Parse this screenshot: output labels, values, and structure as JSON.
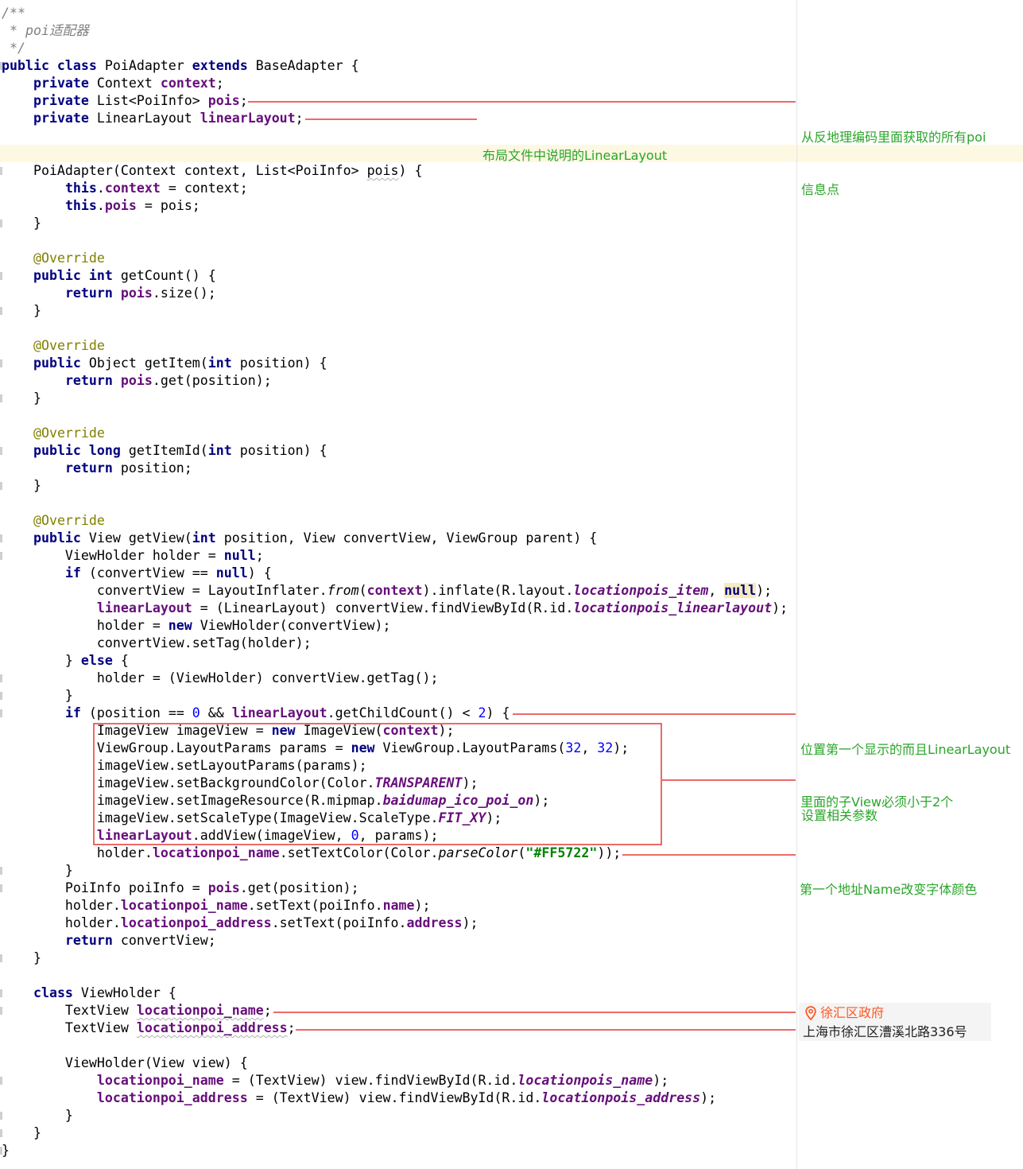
{
  "code": [
    [
      [
        "cmt",
        "/**"
      ]
    ],
    [
      [
        "cmt",
        " * poi适配器"
      ]
    ],
    [
      [
        "cmt",
        " */"
      ]
    ],
    [
      [
        "kw",
        "public class "
      ],
      [
        "",
        "PoiAdapter "
      ],
      [
        "kw",
        "extends "
      ],
      [
        "",
        "BaseAdapter {"
      ]
    ],
    [
      [
        "",
        "    "
      ],
      [
        "kw",
        "private "
      ],
      [
        "",
        "Context "
      ],
      [
        "fld",
        "context"
      ],
      [
        "",
        ";"
      ]
    ],
    [
      [
        "",
        "    "
      ],
      [
        "kw",
        "private "
      ],
      [
        "",
        "List<PoiInfo> "
      ],
      [
        "fld",
        "pois"
      ],
      [
        "",
        ";"
      ]
    ],
    [
      [
        "",
        "    "
      ],
      [
        "kw",
        "private "
      ],
      [
        "",
        "LinearLayout "
      ],
      [
        "fld",
        "linearLayout"
      ],
      [
        "",
        ";"
      ]
    ],
    [],
    [],
    [
      [
        "",
        "    PoiAdapter(Context context, List<PoiInfo> "
      ],
      [
        "sq",
        "pois"
      ],
      [
        "",
        ") {"
      ]
    ],
    [
      [
        "",
        "        "
      ],
      [
        "kw",
        "this"
      ],
      [
        "",
        "."
      ],
      [
        "fld",
        "context"
      ],
      [
        "",
        " = context;"
      ]
    ],
    [
      [
        "",
        "        "
      ],
      [
        "kw",
        "this"
      ],
      [
        "",
        "."
      ],
      [
        "fld",
        "pois"
      ],
      [
        "",
        " = pois;"
      ]
    ],
    [
      [
        "",
        "    }"
      ]
    ],
    [],
    [
      [
        "",
        "    "
      ],
      [
        "ann",
        "@Override"
      ]
    ],
    [
      [
        "",
        "    "
      ],
      [
        "kw",
        "public int "
      ],
      [
        "",
        "getCount() {"
      ]
    ],
    [
      [
        "",
        "        "
      ],
      [
        "kw",
        "return "
      ],
      [
        "fld",
        "pois"
      ],
      [
        "",
        ".size();"
      ]
    ],
    [
      [
        "",
        "    }"
      ]
    ],
    [],
    [
      [
        "",
        "    "
      ],
      [
        "ann",
        "@Override"
      ]
    ],
    [
      [
        "",
        "    "
      ],
      [
        "kw",
        "public "
      ],
      [
        "",
        "Object getItem("
      ],
      [
        "kw",
        "int "
      ],
      [
        "",
        "position) {"
      ]
    ],
    [
      [
        "",
        "        "
      ],
      [
        "kw",
        "return "
      ],
      [
        "fld",
        "pois"
      ],
      [
        "",
        ".get(position);"
      ]
    ],
    [
      [
        "",
        "    }"
      ]
    ],
    [],
    [
      [
        "",
        "    "
      ],
      [
        "ann",
        "@Override"
      ]
    ],
    [
      [
        "",
        "    "
      ],
      [
        "kw",
        "public long "
      ],
      [
        "",
        "getItemId("
      ],
      [
        "kw",
        "int "
      ],
      [
        "",
        "position) {"
      ]
    ],
    [
      [
        "",
        "        "
      ],
      [
        "kw",
        "return "
      ],
      [
        "",
        "position;"
      ]
    ],
    [
      [
        "",
        "    }"
      ]
    ],
    [],
    [
      [
        "",
        "    "
      ],
      [
        "ann",
        "@Override"
      ]
    ],
    [
      [
        "",
        "    "
      ],
      [
        "kw",
        "public "
      ],
      [
        "",
        "View getView("
      ],
      [
        "kw",
        "int "
      ],
      [
        "",
        "position, View convertView, ViewGroup parent) {"
      ]
    ],
    [
      [
        "",
        "        ViewHolder holder = "
      ],
      [
        "kw",
        "null"
      ],
      [
        "",
        ";"
      ]
    ],
    [
      [
        "",
        "        "
      ],
      [
        "kw",
        "if "
      ],
      [
        "",
        "(convertView == "
      ],
      [
        "kw",
        "null"
      ],
      [
        "",
        ") {"
      ]
    ],
    [
      [
        "",
        "            convertView = LayoutInflater."
      ],
      [
        "smeth",
        "from"
      ],
      [
        "",
        "("
      ],
      [
        "fld",
        "context"
      ],
      [
        "",
        ").inflate(R.layout."
      ],
      [
        "sfld",
        "locationpois_item"
      ],
      [
        "",
        ", "
      ],
      [
        "kw hl",
        "null"
      ],
      [
        "",
        ");"
      ]
    ],
    [
      [
        "",
        "            "
      ],
      [
        "fld",
        "linearLayout"
      ],
      [
        "",
        " = (LinearLayout) convertView.findViewById(R.id."
      ],
      [
        "sfld",
        "locationpois_linearlayout"
      ],
      [
        "",
        ");"
      ]
    ],
    [
      [
        "",
        "            holder = "
      ],
      [
        "kw",
        "new "
      ],
      [
        "",
        "ViewHolder(convertView);"
      ]
    ],
    [
      [
        "",
        "            convertView.setTag(holder);"
      ]
    ],
    [
      [
        "",
        "        } "
      ],
      [
        "kw",
        "else "
      ],
      [
        "",
        "{"
      ]
    ],
    [
      [
        "",
        "            holder = (ViewHolder) convertView.getTag();"
      ]
    ],
    [
      [
        "",
        "        }"
      ]
    ],
    [
      [
        "",
        "        "
      ],
      [
        "kw",
        "if "
      ],
      [
        "",
        "(position == "
      ],
      [
        "num",
        "0"
      ],
      [
        "",
        " && "
      ],
      [
        "fld",
        "linearLayout"
      ],
      [
        "",
        ".getChildCount() < "
      ],
      [
        "num",
        "2"
      ],
      [
        "",
        ") {"
      ]
    ],
    [
      [
        "",
        "            ImageView imageView = "
      ],
      [
        "kw",
        "new "
      ],
      [
        "",
        "ImageView("
      ],
      [
        "fld",
        "context"
      ],
      [
        "",
        ");"
      ]
    ],
    [
      [
        "",
        "            ViewGroup.LayoutParams params = "
      ],
      [
        "kw",
        "new "
      ],
      [
        "",
        "ViewGroup.LayoutParams("
      ],
      [
        "num",
        "32"
      ],
      [
        "",
        ", "
      ],
      [
        "num",
        "32"
      ],
      [
        "",
        ");"
      ]
    ],
    [
      [
        "",
        "            imageView.setLayoutParams(params);"
      ]
    ],
    [
      [
        "",
        "            imageView.setBackgroundColor(Color."
      ],
      [
        "sfld",
        "TRANSPARENT"
      ],
      [
        "",
        ");"
      ]
    ],
    [
      [
        "",
        "            imageView.setImageResource(R.mipmap."
      ],
      [
        "sfld",
        "baidumap_ico_poi_on"
      ],
      [
        "",
        ");"
      ]
    ],
    [
      [
        "",
        "            imageView.setScaleType(ImageView.ScaleType."
      ],
      [
        "sfld",
        "FIT_XY"
      ],
      [
        "",
        ");"
      ]
    ],
    [
      [
        "",
        "            "
      ],
      [
        "fld",
        "linearLayout"
      ],
      [
        "",
        ".addView(imageView, "
      ],
      [
        "num",
        "0"
      ],
      [
        "",
        ", params);"
      ]
    ],
    [
      [
        "",
        "            holder."
      ],
      [
        "fld",
        "locationpoi_name"
      ],
      [
        "",
        ".setTextColor(Color."
      ],
      [
        "smeth",
        "parseColor"
      ],
      [
        "",
        "("
      ],
      [
        "str",
        "\"#FF5722\""
      ],
      [
        "",
        "));"
      ]
    ],
    [
      [
        "",
        "        }"
      ]
    ],
    [
      [
        "",
        "        PoiInfo poiInfo = "
      ],
      [
        "fld",
        "pois"
      ],
      [
        "",
        ".get(position);"
      ]
    ],
    [
      [
        "",
        "        holder."
      ],
      [
        "fld",
        "locationpoi_name"
      ],
      [
        "",
        ".setText(poiInfo."
      ],
      [
        "fld",
        "name"
      ],
      [
        "",
        ");"
      ]
    ],
    [
      [
        "",
        "        holder."
      ],
      [
        "fld",
        "locationpoi_address"
      ],
      [
        "",
        ".setText(poiInfo."
      ],
      [
        "fld",
        "address"
      ],
      [
        "",
        ");"
      ]
    ],
    [
      [
        "",
        "        "
      ],
      [
        "kw",
        "return "
      ],
      [
        "",
        "convertView;"
      ]
    ],
    [
      [
        "",
        "    }"
      ]
    ],
    [],
    [
      [
        "",
        "    "
      ],
      [
        "kw",
        "class "
      ],
      [
        "",
        "ViewHolder {"
      ]
    ],
    [
      [
        "",
        "        TextView "
      ],
      [
        "fld sq",
        "locationpoi_name"
      ],
      [
        "",
        ";"
      ]
    ],
    [
      [
        "",
        "        TextView "
      ],
      [
        "fld sq",
        "locationpoi_address"
      ],
      [
        "",
        ";"
      ]
    ],
    [],
    [
      [
        "",
        "        ViewHolder(View view) {"
      ]
    ],
    [
      [
        "",
        "            "
      ],
      [
        "fld",
        "locationpoi_name"
      ],
      [
        "",
        " = (TextView) view.findViewById(R.id."
      ],
      [
        "sfld",
        "locationpois_name"
      ],
      [
        "",
        ");"
      ]
    ],
    [
      [
        "",
        "            "
      ],
      [
        "fld",
        "locationpoi_address"
      ],
      [
        "",
        " = (TextView) view.findViewById(R.id."
      ],
      [
        "sfld",
        "locationpois_address"
      ],
      [
        "",
        ");"
      ]
    ],
    [
      [
        "",
        "        }"
      ]
    ],
    [
      [
        "",
        "    }"
      ]
    ],
    [
      [
        "",
        "}"
      ]
    ]
  ],
  "notes": {
    "pois_note": [
      "从反地理编码里面获取的所有poi",
      "信息点"
    ],
    "layout_note": [
      "布局文件中说明的LinearLayout"
    ],
    "position_note": [
      "位置第一个显示的而且LinearLayout",
      "里面的子View必须小于2个"
    ],
    "params_note": [
      "设置相关参数"
    ],
    "color_note": [
      "第一个地址Name改变字体颜色"
    ]
  },
  "preview": {
    "name": "徐汇区政府",
    "address": "上海市徐汇区漕溪北路336号",
    "icon": "location-pin-icon",
    "name_color": "#FF5722"
  },
  "colors": {
    "keyword": "#000080",
    "field": "#660E7A",
    "annotation": "#808000",
    "comment": "#808080",
    "number": "#0000FF",
    "string": "#008000",
    "note_text": "#2AA52A",
    "arrow_line": "#E53935"
  }
}
